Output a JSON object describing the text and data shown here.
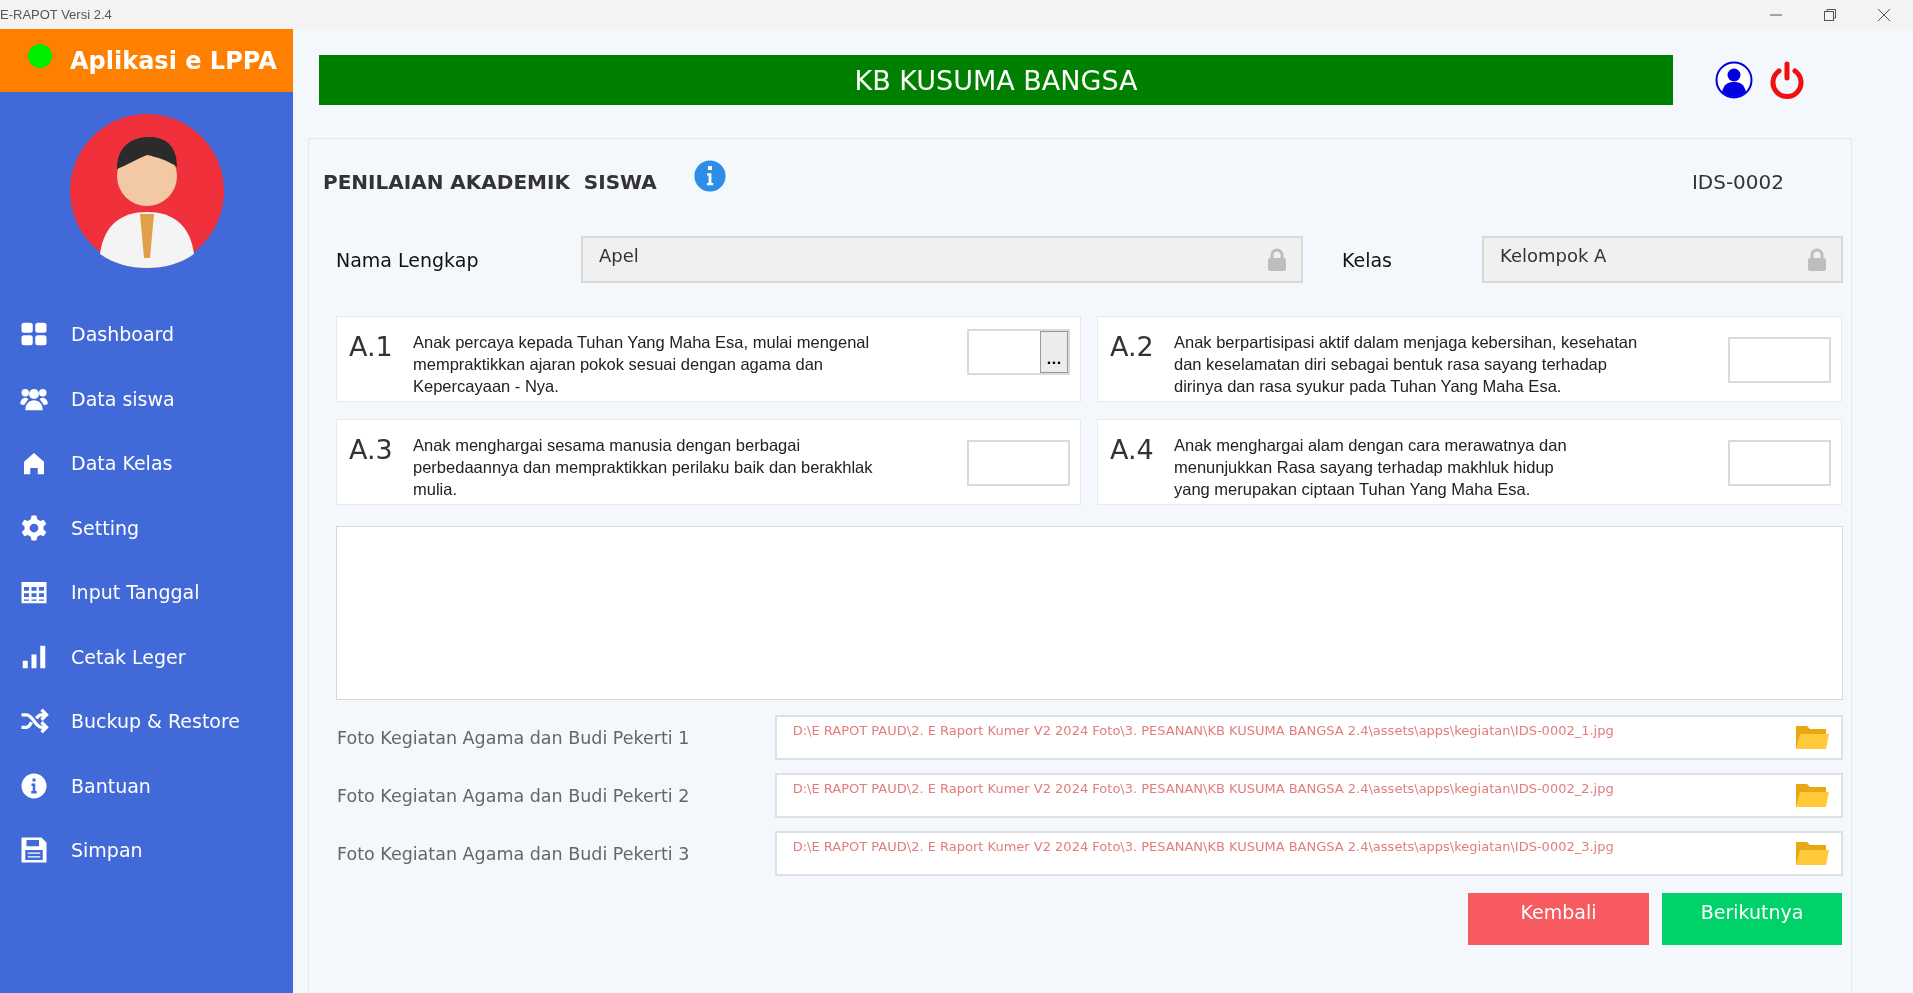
{
  "window": {
    "title": "E-RAPOT Versi 2.4"
  },
  "sidebar": {
    "app_title": "Aplikasi e LPPA",
    "items": [
      {
        "label": "Dashboard"
      },
      {
        "label": "Data siswa"
      },
      {
        "label": "Data Kelas"
      },
      {
        "label": "Setting"
      },
      {
        "label": "Input Tanggal"
      },
      {
        "label": "Cetak Leger"
      },
      {
        "label": "Buckup & Restore"
      },
      {
        "label": "Bantuan"
      },
      {
        "label": "Simpan"
      }
    ]
  },
  "header": {
    "school": "KB KUSUMA BANGSA"
  },
  "panel": {
    "title": "PENILAIAN AKADEMIK  SISWA",
    "student_id": "IDS-0002",
    "fields": [
      {
        "label": "Nama Lengkap",
        "value": "Apel",
        "locked": true
      },
      {
        "label": "Kelas",
        "value": "Kelompok A",
        "locked": true
      }
    ],
    "indicators": [
      {
        "code": "A.1",
        "kind": "picker",
        "text": "Anak percaya kepada Tuhan Yang Maha Esa, mulai mengenal\nmempraktikkan ajaran pokok sesuai dengan agama dan\nKepercayaan - Nya.",
        "button": "..."
      },
      {
        "code": "A.2",
        "kind": "plain",
        "text": "Anak berpartisipasi aktif dalam menjaga kebersihan, kesehatan\ndan keselamatan diri sebagai bentuk rasa sayang terhadap\ndirinya dan rasa syukur pada Tuhan Yang Maha Esa."
      },
      {
        "code": "A.3",
        "kind": "plain",
        "text": "Anak menghargai sesama manusia dengan berbagai\nperbedaannya  dan mempraktikkan perilaku baik dan berakhlak\nmulia."
      },
      {
        "code": "A.4",
        "kind": "plain",
        "text": "Anak menghargai alam dengan cara merawatnya dan\nmenunjukkan Rasa sayang terhadap makhluk hidup\nyang merupakan ciptaan Tuhan Yang Maha Esa."
      }
    ],
    "photos": [
      {
        "label": "Foto Kegiatan Agama dan Budi Pekerti 1",
        "path": "D:\\E RAPOT PAUD\\2. E Raport Kumer V2 2024 Foto\\3. PESANAN\\KB KUSUMA BANGSA 2.4\\assets\\apps\\kegiatan\\IDS-0002_1.jpg"
      },
      {
        "label": "Foto Kegiatan Agama dan Budi Pekerti 2",
        "path": "D:\\E RAPOT PAUD\\2. E Raport Kumer V2 2024 Foto\\3. PESANAN\\KB KUSUMA BANGSA 2.4\\assets\\apps\\kegiatan\\IDS-0002_2.jpg"
      },
      {
        "label": "Foto Kegiatan Agama dan Budi Pekerti 3",
        "path": "D:\\E RAPOT PAUD\\2. E Raport Kumer V2 2024 Foto\\3. PESANAN\\KB KUSUMA BANGSA 2.4\\assets\\apps\\kegiatan\\IDS-0002_3.jpg"
      }
    ],
    "buttons": [
      {
        "label": "Kembali",
        "kind": "back"
      },
      {
        "label": "Berikutnya",
        "kind": "next"
      }
    ]
  }
}
